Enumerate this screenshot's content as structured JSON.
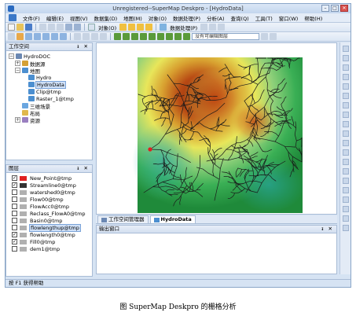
{
  "window": {
    "title": "Unregistered--SuperMap Deskpro - [HydroData]"
  },
  "menu": [
    "文件(F)",
    "编辑(E)",
    "视图(V)",
    "数据集(D)",
    "地图(M)",
    "对象(O)",
    "数据处理(P)",
    "分析(A)",
    "查询(Q)",
    "工具(T)",
    "窗口(W)",
    "帮助(H)"
  ],
  "toolbar": {
    "object_label": "对象(O)",
    "process_label": "数据处理(P)",
    "layer_combo": "没有可编辑图层"
  },
  "workspace": {
    "panel_title": "工作空间",
    "controls": "ᵻ ✕",
    "root": "HydroDOC",
    "datasource": "数据源",
    "maps": "地图",
    "map_items": [
      "Hydro",
      "HydroData",
      "Clip@tmp",
      "Raster_1@tmp"
    ],
    "scenes": "三维场景",
    "layouts": "布局",
    "resources": "资源"
  },
  "layers": {
    "panel_title": "图层",
    "controls": "ᵻ ✕",
    "items": [
      {
        "name": "New_Point@tmp",
        "checked": true,
        "icon_color": "#e02020"
      },
      {
        "name": "Streamline0@tmp",
        "checked": true,
        "icon_color": "#333333"
      },
      {
        "name": "watershed0@tmp",
        "checked": false,
        "icon_color": "#b0b0b0"
      },
      {
        "name": "Flow00@tmp",
        "checked": false,
        "icon_color": "#b0b0b0"
      },
      {
        "name": "FlowAcc0@tmp",
        "checked": false,
        "icon_color": "#b0b0b0"
      },
      {
        "name": "Reclass_FlowA0@tmp",
        "checked": false,
        "icon_color": "#b0b0b0"
      },
      {
        "name": "Basin0@tmp",
        "checked": false,
        "icon_color": "#b0b0b0"
      },
      {
        "name": "flowlengthup@tmp",
        "checked": false,
        "icon_color": "#b0b0b0"
      },
      {
        "name": "flowlength0@tmp",
        "checked": true,
        "icon_color": "#b0b0b0"
      },
      {
        "name": "Fill0@tmp",
        "checked": true,
        "icon_color": "#b0b0b0"
      },
      {
        "name": "dem1@tmp",
        "checked": false,
        "icon_color": "#b0b0b0"
      }
    ]
  },
  "tabs": [
    "工作空间管理器",
    "HydroData"
  ],
  "output": {
    "title": "输出窗口",
    "controls": "ᵻ ✕"
  },
  "status": "按 F1 获得帮助",
  "caption": "图    SuperMap Deskpro 的栅格分析",
  "colors": {
    "dem_low": "#1f9e3a",
    "dem_mid": "#e8e65a",
    "dem_high": "#8b2a0a",
    "stream": "#1a1a1a",
    "point": "#e02020"
  }
}
